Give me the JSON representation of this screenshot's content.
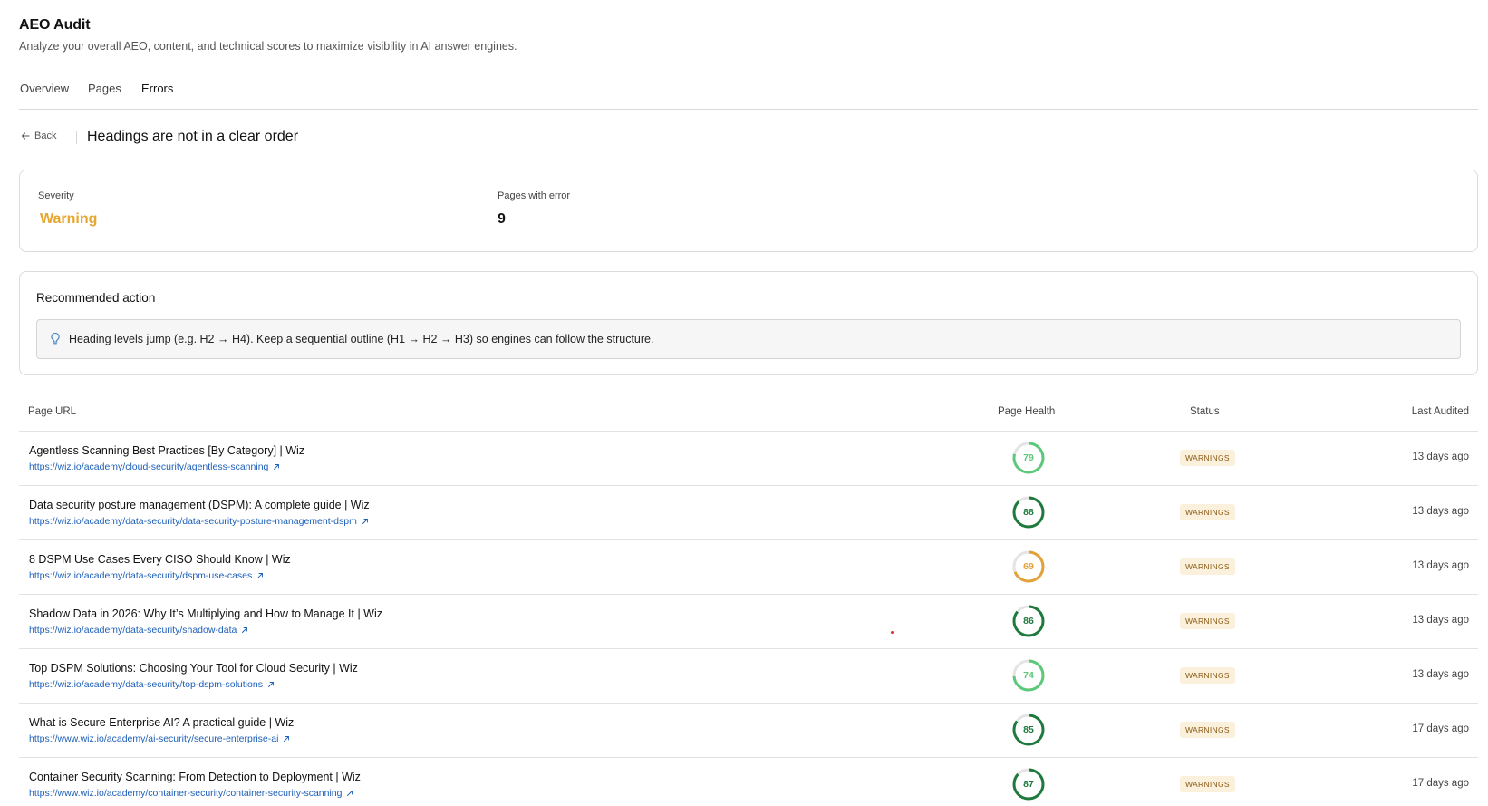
{
  "header": {
    "title": "AEO Audit",
    "subtitle": "Analyze your overall AEO, content, and technical scores to maximize visibility in AI answer engines."
  },
  "tabs": [
    {
      "label": "Overview",
      "active": false
    },
    {
      "label": "Pages",
      "active": false
    },
    {
      "label": "Errors",
      "active": true
    }
  ],
  "error": {
    "back_label": "Back",
    "title": "Headings are not in a clear order"
  },
  "summary": {
    "severity_label": "Severity",
    "severity_value": "Warning",
    "severity_color": "#e7a62e",
    "pages_label": "Pages with error",
    "pages_value": "9"
  },
  "recommendation": {
    "title": "Recommended action",
    "text": "Heading levels jump (e.g. H2 → H4). Keep a sequential outline (H1 → H2 → H3) so engines can follow the structure.",
    "icon": "lightbulb-icon"
  },
  "table": {
    "columns": {
      "url": "Page URL",
      "health": "Page Health",
      "status": "Status",
      "audited": "Last Audited"
    },
    "rows": [
      {
        "title": "Agentless Scanning Best Practices [By Category] | Wiz",
        "url": "https://wiz.io/academy/cloud-security/agentless-scanning",
        "health": 79,
        "health_label": "79",
        "color": "#5cc97a",
        "status": "WARNINGS",
        "audited": "13 days ago"
      },
      {
        "title": "Data security posture management (DSPM): A complete guide | Wiz",
        "url": "https://wiz.io/academy/data-security/data-security-posture-management-dspm",
        "health": 88,
        "health_label": "88",
        "color": "#1e7a3c",
        "status": "WARNINGS",
        "audited": "13 days ago"
      },
      {
        "title": "8 DSPM Use Cases Every CISO Should Know | Wiz",
        "url": "https://wiz.io/academy/data-security/dspm-use-cases",
        "health": 69,
        "health_label": "69",
        "color": "#e3a238",
        "status": "WARNINGS",
        "audited": "13 days ago"
      },
      {
        "title": "Shadow Data in 2026: Why It’s Multiplying and How to Manage It | Wiz",
        "url": "https://wiz.io/academy/data-security/shadow-data",
        "health": 86,
        "health_label": "86",
        "color": "#1e7a3c",
        "status": "WARNINGS",
        "audited": "13 days ago"
      },
      {
        "title": "Top DSPM Solutions: Choosing Your Tool for Cloud Security | Wiz",
        "url": "https://wiz.io/academy/data-security/top-dspm-solutions",
        "health": 74,
        "health_label": "74",
        "color": "#5cc97a",
        "status": "WARNINGS",
        "audited": "13 days ago"
      },
      {
        "title": "What is Secure Enterprise AI? A practical guide | Wiz",
        "url": "https://www.wiz.io/academy/ai-security/secure-enterprise-ai",
        "health": 85,
        "health_label": "85",
        "color": "#1e7a3c",
        "status": "WARNINGS",
        "audited": "17 days ago"
      },
      {
        "title": "Container Security Scanning: From Detection to Deployment | Wiz",
        "url": "https://www.wiz.io/academy/container-security/container-security-scanning",
        "health": 87,
        "health_label": "87",
        "color": "#1e7a3c",
        "status": "WARNINGS",
        "audited": "17 days ago"
      }
    ]
  }
}
